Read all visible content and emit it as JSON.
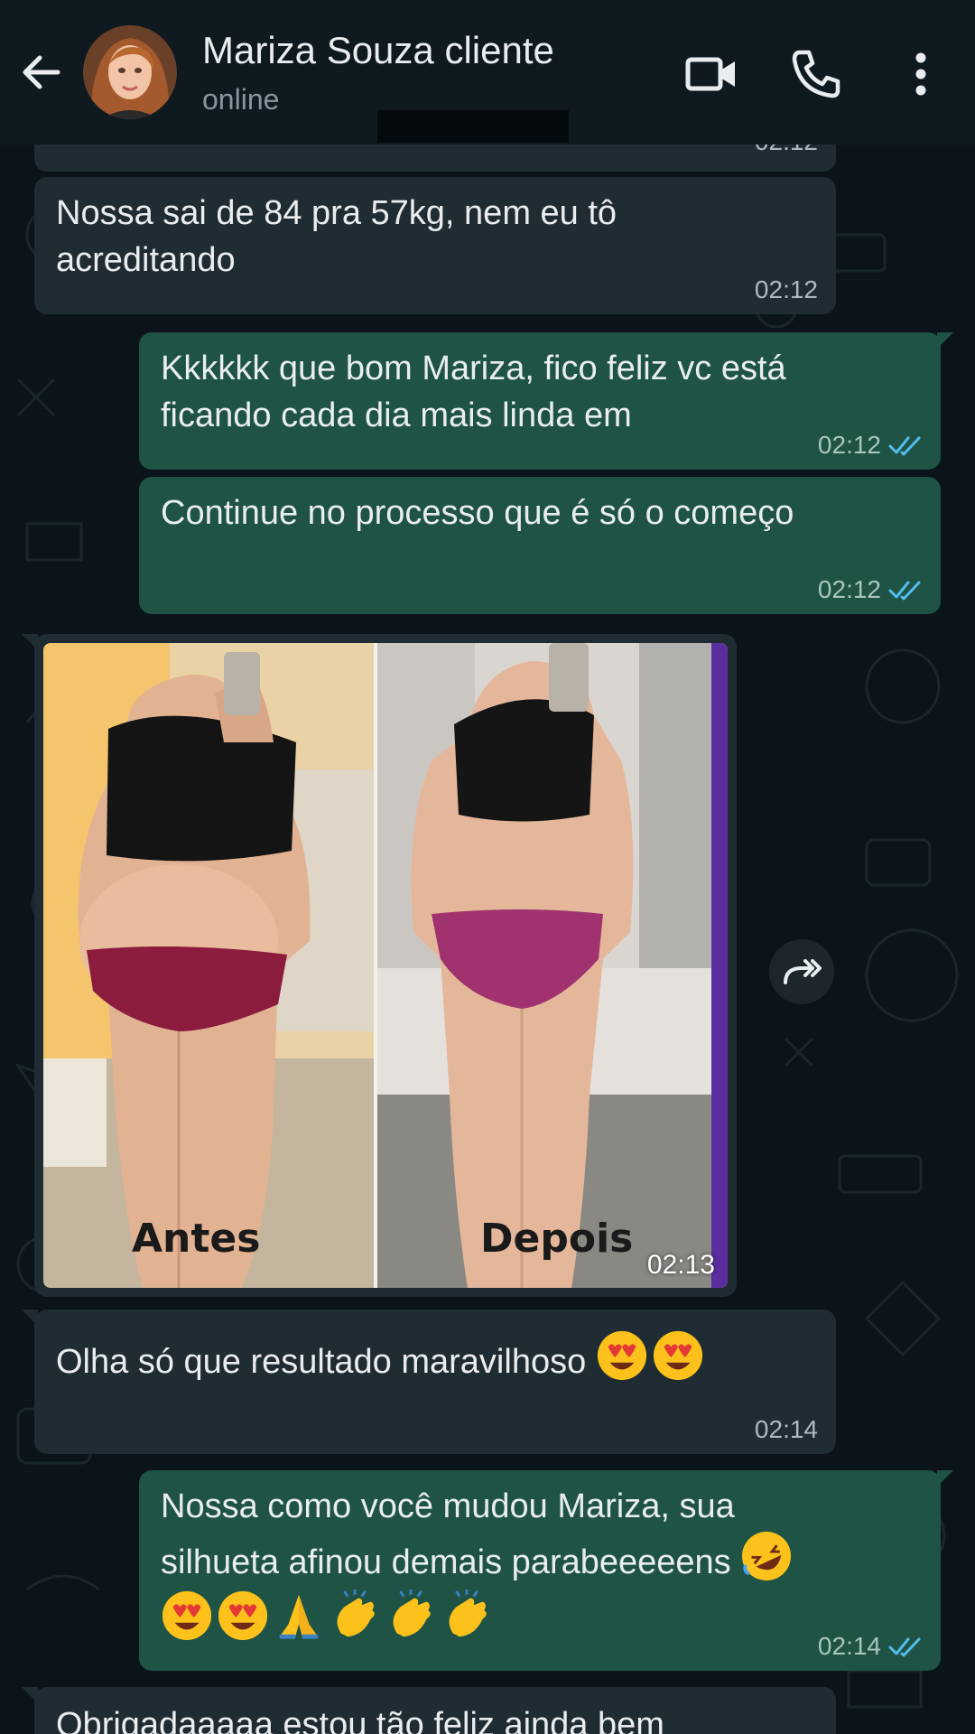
{
  "header": {
    "contact_name": "Mariza Souza cliente",
    "status": "online",
    "icons": [
      "back-arrow-icon",
      "video-call-icon",
      "phone-icon",
      "more-vert-icon"
    ]
  },
  "colors": {
    "background": "#0b141a",
    "incoming_bubble": "#1f2c33",
    "outgoing_bubble": "#1e5345",
    "read_ticks": "#53bdeb"
  },
  "messages": [
    {
      "direction": "in",
      "partial": true,
      "time": "02:12"
    },
    {
      "direction": "in",
      "lines": [
        "Nossa sai de 84 pra 57kg, nem eu tô",
        "acreditando"
      ],
      "time": "02:12"
    },
    {
      "direction": "out",
      "lines": [
        "Kkkkkk que bom Mariza, fico feliz vc está",
        "ficando cada dia mais linda em"
      ],
      "time": "02:12",
      "status": "read"
    },
    {
      "direction": "out",
      "lines": [
        "Continue no processo que é só o começo"
      ],
      "time": "02:12",
      "status": "read"
    },
    {
      "direction": "in",
      "type": "image",
      "labels": {
        "left": "Antes",
        "right": "Depois"
      },
      "time": "02:13"
    },
    {
      "direction": "in",
      "lines": [
        "Olha só que resultado maravilhoso"
      ],
      "emojis": [
        "heart-eyes",
        "heart-eyes"
      ],
      "time": "02:14"
    },
    {
      "direction": "out",
      "lines": [
        "Nossa como você mudou Mariza, sua",
        "silhueta  afinou demais parabeeeeens"
      ],
      "emojis": [
        "rofl",
        "heart-eyes",
        "heart-eyes",
        "folded-hands",
        "clapping-hands",
        "clapping-hands",
        "clapping-hands"
      ],
      "time": "02:14",
      "status": "read"
    },
    {
      "direction": "in",
      "partial": true,
      "lines": [
        "Obrigadaaaaa estou tão feliz ainda bem"
      ]
    }
  ]
}
